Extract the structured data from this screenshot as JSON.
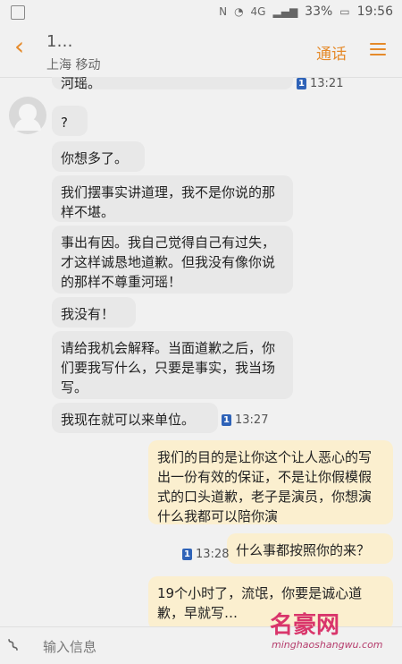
{
  "status": {
    "time": "19:56",
    "battery": "33%",
    "network": "4G"
  },
  "header": {
    "title": "1…",
    "subtitle": "上海 移动",
    "call": "通话"
  },
  "messages": {
    "m1": "河瑶。",
    "t1": "13:21",
    "m2": "?",
    "m3": "你想多了。",
    "m4": "我们摆事实讲道理，我不是你说的那样不堪。",
    "m5": "事出有因。我自己觉得自己有过失，才这样诚恳地道歉。但我没有像你说的那样不尊重河瑶！",
    "m6": "我没有！",
    "m7": "请给我机会解释。当面道歉之后，你们要我写什么，只要是事实，我当场写。",
    "m8": "我现在就可以来单位。",
    "t2": "13:27",
    "m9": "我们的目的是让你这个让人恶心的写出一份有效的保证，不是让你假模假式的口头道歉，老子是演员，你想演什么我都可以陪你演",
    "m10": "什么事都按照你的来？",
    "t3": "13:28",
    "m11": "19个小时了，流氓，你要是诚心道歉，早就写…"
  },
  "input": {
    "placeholder": "输入信息"
  },
  "watermark": {
    "main": "名豪网",
    "sub": "minghaoshangwu.com"
  }
}
